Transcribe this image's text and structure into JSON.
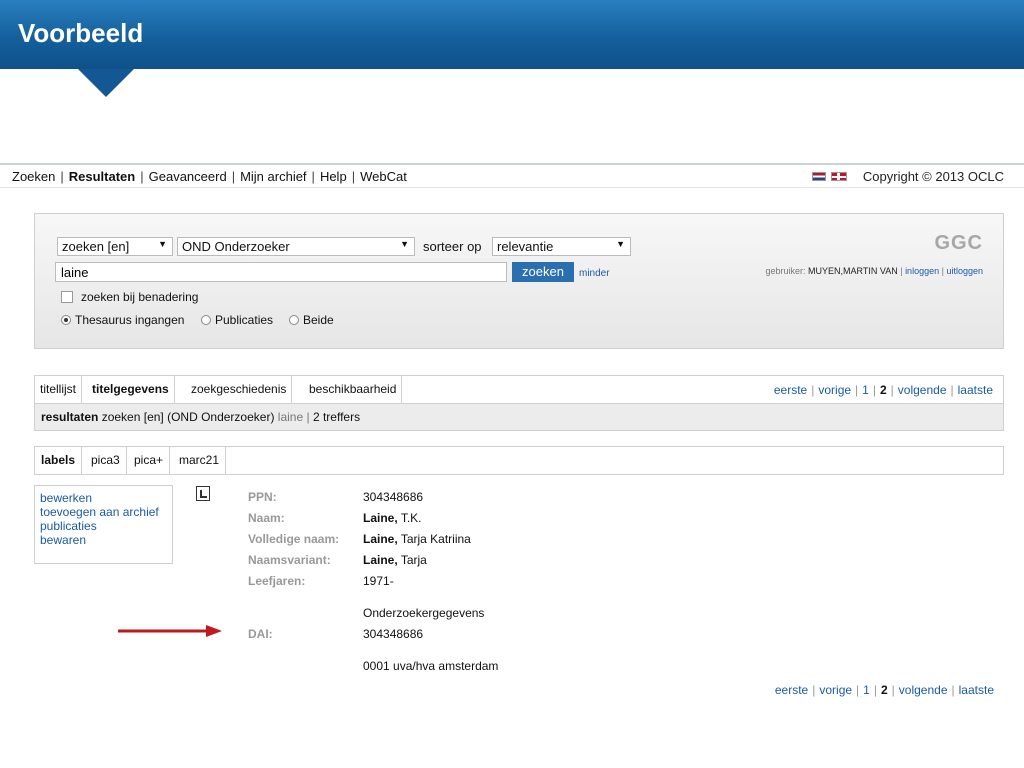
{
  "slide": {
    "title": "Voorbeeld"
  },
  "nav": {
    "items": [
      "Zoeken",
      "Resultaten",
      "Geavanceerd",
      "Mijn archief",
      "Help",
      "WebCat"
    ],
    "separator": "|",
    "copyright": "Copyright © 2013 OCLC"
  },
  "search": {
    "mode_select": "zoeken [en]",
    "field_select": "OND Onderzoeker",
    "sort_label": "sorteer op",
    "sort_select": "relevantie",
    "query": "laine",
    "button": "zoeken",
    "minder": "minder",
    "logo": "GGC",
    "user_label": "gebruiker:",
    "user_name": "MUYEN,MARTIN VAN",
    "login": "inloggen",
    "logout": "uitloggen",
    "approx_label": "zoeken bij benadering",
    "radio_thesaurus": "Thesaurus ingangen",
    "radio_publicaties": "Publicaties",
    "radio_beide": "Beide"
  },
  "results_tabs": [
    "titellijst",
    "titelgegevens",
    "zoekgeschiedenis",
    "beschikbaarheid"
  ],
  "pager": {
    "first": "eerste",
    "prev": "vorige",
    "p1": "1",
    "p2": "2",
    "next": "volgende",
    "last": "laatste"
  },
  "results_bar": {
    "label": "resultaten",
    "query_desc": "zoeken [en] (OND Onderzoeker)",
    "term": "laine",
    "count": "2 treffers"
  },
  "format_tabs": [
    "labels",
    "pica3",
    "pica+",
    "marc21"
  ],
  "actions": [
    "bewerken",
    "toevoegen aan archief",
    "publicaties",
    "bewaren"
  ],
  "record": {
    "ppn_label": "PPN:",
    "ppn": "304348686",
    "naam_label": "Naam:",
    "naam_bold": "Laine,",
    "naam_rest": "T.K.",
    "volledig_label": "Volledige naam:",
    "volledig_bold": "Laine,",
    "volledig_rest": "Tarja Katriina",
    "variant_label": "Naamsvariant:",
    "variant_bold": "Laine,",
    "variant_rest": "Tarja",
    "leefjaren_label": "Leefjaren:",
    "leefjaren": "1971-",
    "onderzoeker": "Onderzoekergegevens",
    "dai_label": "DAI:",
    "dai": "304348686",
    "affiliation": "0001 uva/hva amsterdam"
  },
  "colors": {
    "header": "#14609c",
    "link": "#1a5aa6",
    "arrow": "#c0181d",
    "button": "#2a6fb0"
  }
}
